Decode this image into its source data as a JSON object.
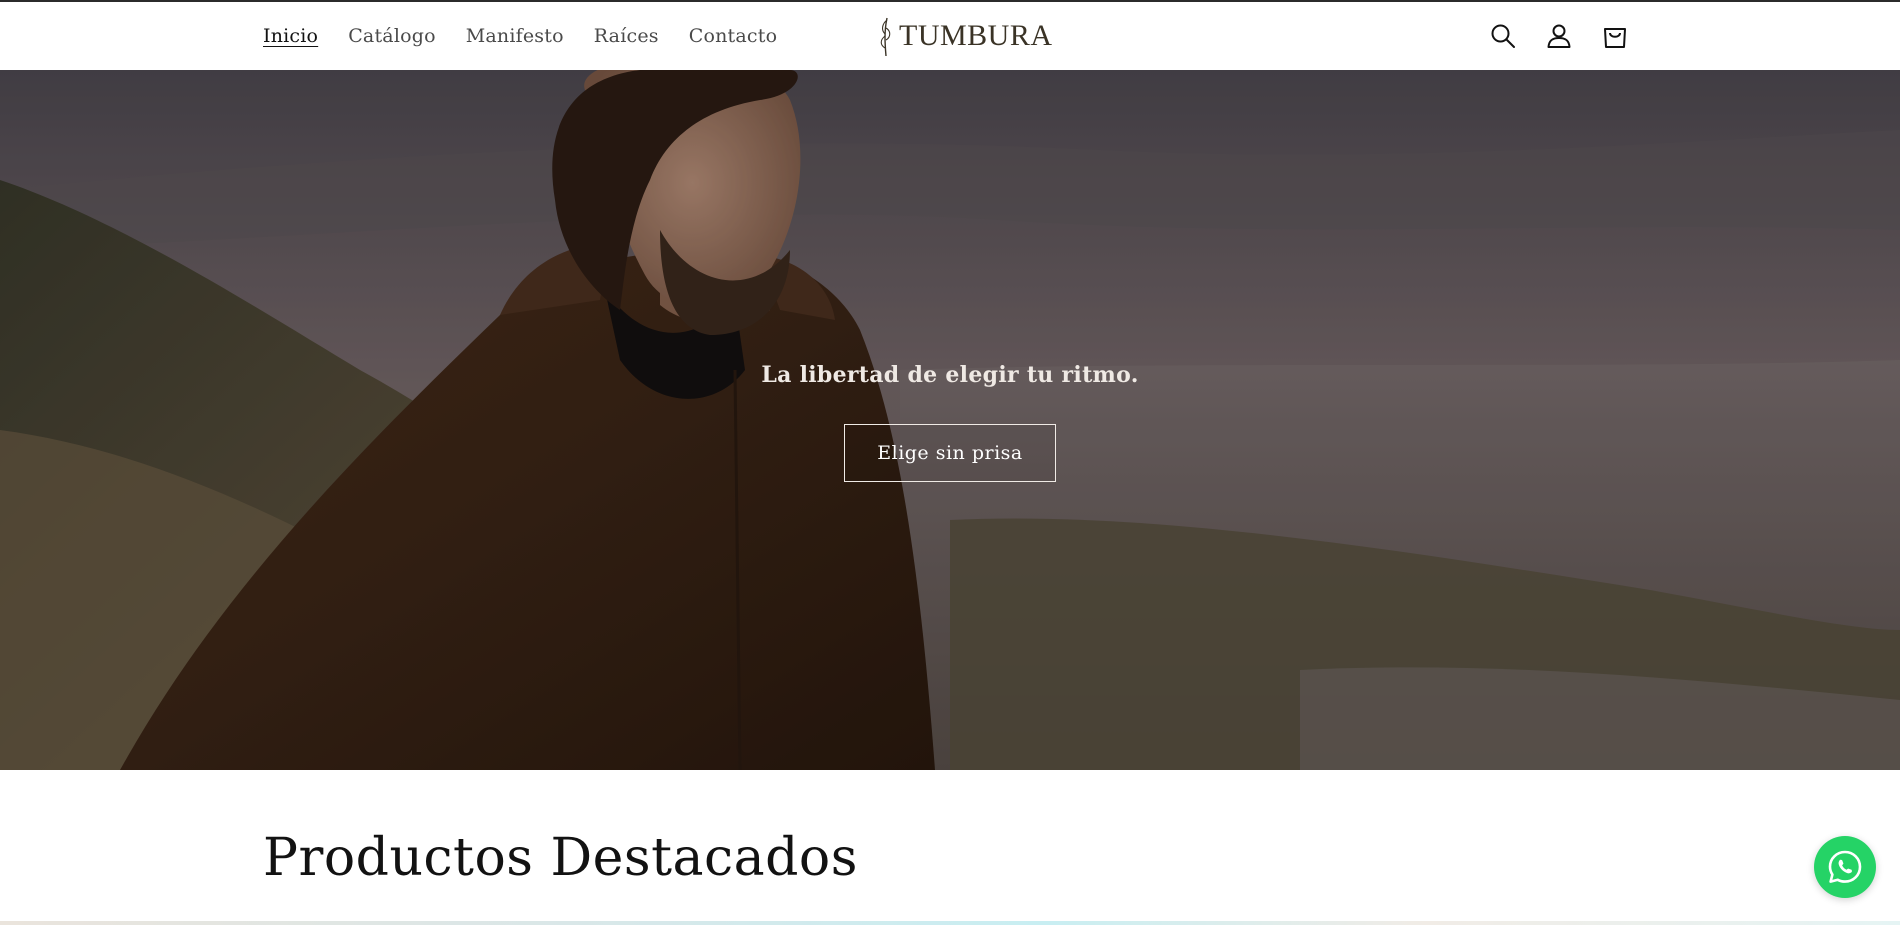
{
  "header": {
    "nav": [
      {
        "label": "Inicio",
        "active": true
      },
      {
        "label": "Catálogo",
        "active": false
      },
      {
        "label": "Manifesto",
        "active": false
      },
      {
        "label": "Raíces",
        "active": false
      },
      {
        "label": "Contacto",
        "active": false
      }
    ],
    "logo_text": "TUMBURA",
    "icons": [
      "search-icon",
      "account-icon",
      "cart-icon"
    ]
  },
  "hero": {
    "title": "La libertad de elegir tu ritmo.",
    "button_label": "Elige sin prisa"
  },
  "featured": {
    "title": "Productos Destacados"
  },
  "floating": {
    "icon": "whatsapp-icon",
    "color": "#25d366"
  },
  "colors": {
    "logo": "#3a3326",
    "text": "#121212",
    "accent_green": "#25d366"
  }
}
